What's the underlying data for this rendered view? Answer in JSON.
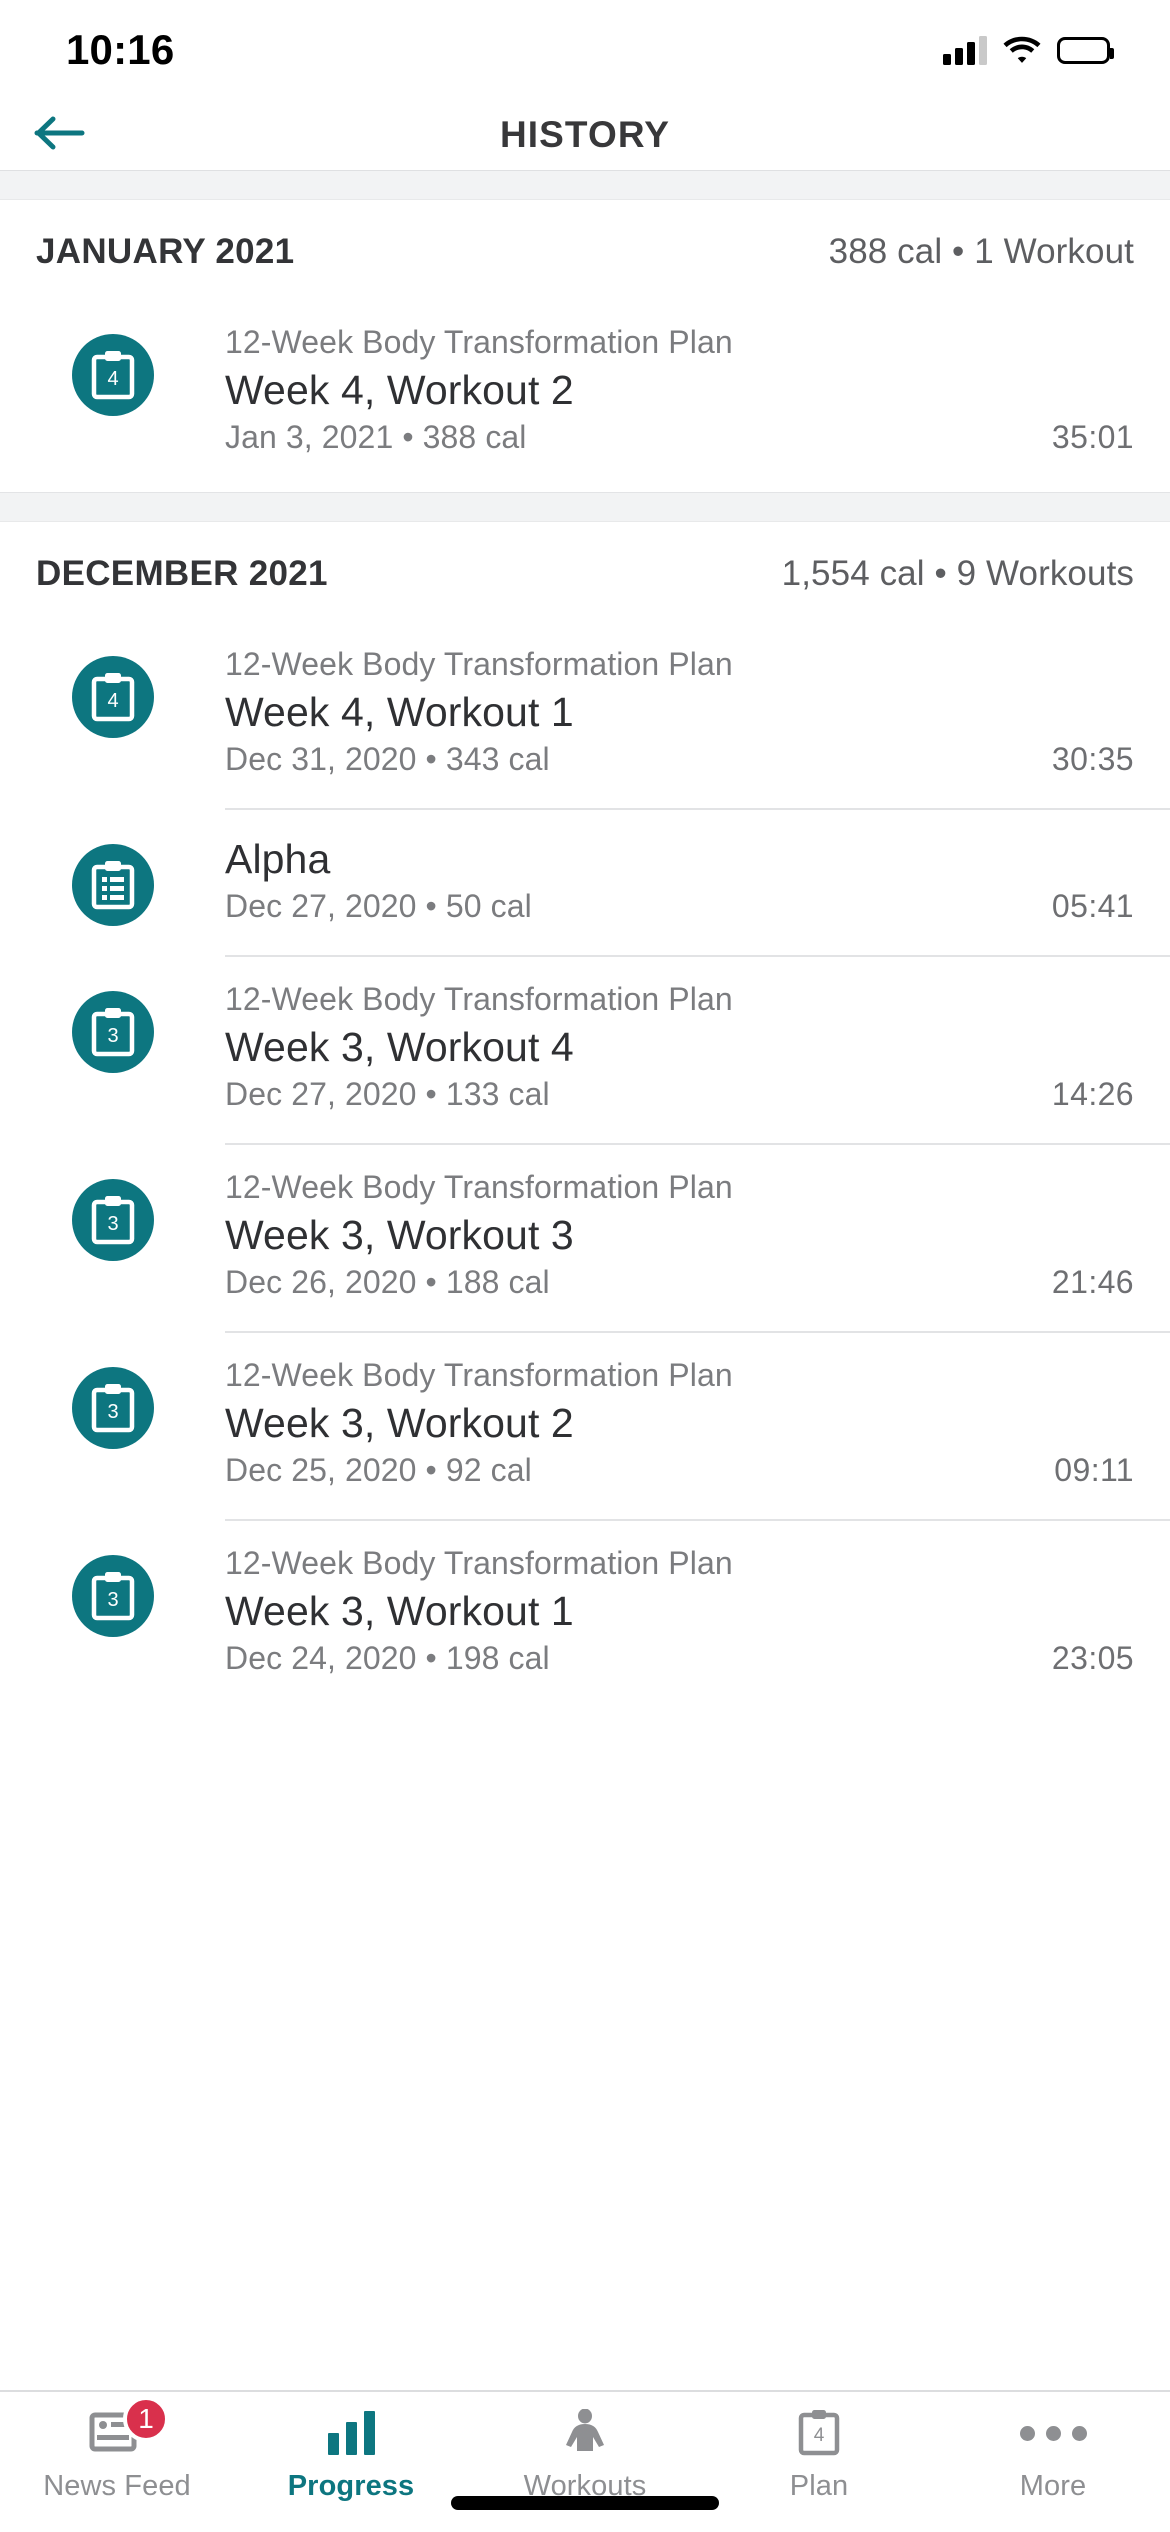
{
  "status_bar": {
    "time": "10:16",
    "cellular_icon": "cellular-signal-icon",
    "wifi_icon": "wifi-icon",
    "battery_icon": "battery-full-icon"
  },
  "header": {
    "title": "HISTORY",
    "back_icon": "back-arrow-icon",
    "accent_color": "#0d7680"
  },
  "colors": {
    "accent": "#0d7680",
    "badge_red": "#d9304c",
    "text_primary": "#2f3033",
    "text_secondary": "#7b7c7f",
    "separator": "#e2e3e5",
    "band": "#f2f3f4"
  },
  "sections": [
    {
      "month": "JANUARY 2021",
      "stats": "388 cal • 1 Workout",
      "workouts": [
        {
          "plan": "12-Week Body Transformation Plan",
          "title": "Week 4, Workout 2",
          "meta": "Jan 3, 2021 • 388 cal",
          "duration": "35:01",
          "icon": "clipboard-week-icon",
          "week_number": "4",
          "show_divider": false
        }
      ]
    },
    {
      "month": "DECEMBER 2021",
      "stats": "1,554 cal • 9 Workouts",
      "workouts": [
        {
          "plan": "12-Week Body Transformation Plan",
          "title": "Week 4, Workout 1",
          "meta": "Dec 31, 2020 • 343 cal",
          "duration": "30:35",
          "icon": "clipboard-week-icon",
          "week_number": "4",
          "show_divider": false
        },
        {
          "plan": "",
          "title": "Alpha",
          "meta": "Dec 27, 2020 • 50 cal",
          "duration": "05:41",
          "icon": "clipboard-list-icon",
          "week_number": "",
          "show_divider": true
        },
        {
          "plan": "12-Week Body Transformation Plan",
          "title": "Week 3, Workout 4",
          "meta": "Dec 27, 2020 • 133 cal",
          "duration": "14:26",
          "icon": "clipboard-week-icon",
          "week_number": "3",
          "show_divider": true
        },
        {
          "plan": "12-Week Body Transformation Plan",
          "title": "Week 3, Workout 3",
          "meta": "Dec 26, 2020 • 188 cal",
          "duration": "21:46",
          "icon": "clipboard-week-icon",
          "week_number": "3",
          "show_divider": true
        },
        {
          "plan": "12-Week Body Transformation Plan",
          "title": "Week 3, Workout 2",
          "meta": "Dec 25, 2020 • 92 cal",
          "duration": "09:11",
          "icon": "clipboard-week-icon",
          "week_number": "3",
          "show_divider": true
        },
        {
          "plan": "12-Week Body Transformation Plan",
          "title": "Week 3, Workout 1",
          "meta": "Dec 24, 2020 • 198 cal",
          "duration": "23:05",
          "icon": "clipboard-week-icon",
          "week_number": "3",
          "show_divider": true
        }
      ]
    }
  ],
  "tabbar": {
    "items": [
      {
        "label": "News Feed",
        "icon": "news-feed-icon",
        "badge": "1",
        "active": false
      },
      {
        "label": "Progress",
        "icon": "bar-chart-icon",
        "badge": "",
        "active": true
      },
      {
        "label": "Workouts",
        "icon": "body-torso-icon",
        "badge": "",
        "active": false
      },
      {
        "label": "Plan",
        "icon": "clipboard-plan-icon",
        "badge": "",
        "active": false,
        "plan_number": "4"
      },
      {
        "label": "More",
        "icon": "ellipsis-icon",
        "badge": "",
        "active": false
      }
    ]
  }
}
